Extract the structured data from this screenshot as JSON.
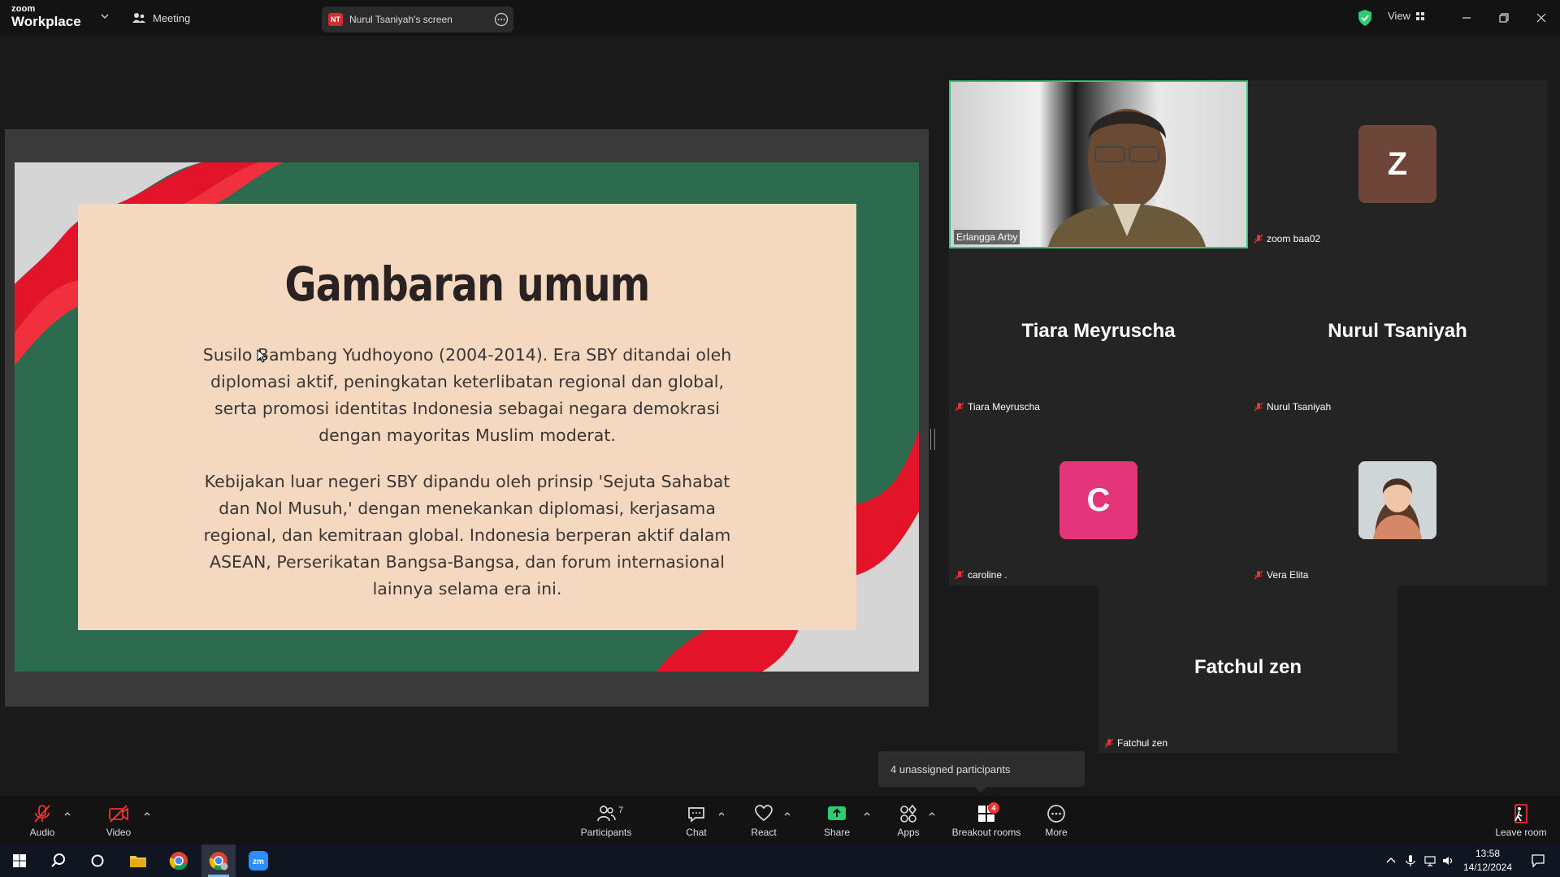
{
  "titlebar": {
    "logo_line1": "zoom",
    "logo_line2": "Workplace",
    "meeting_label": "Meeting",
    "share_badge": "NT",
    "share_label": "Nurul Tsaniyah's screen",
    "view_label": "View"
  },
  "slide": {
    "title": "Gambaran umum",
    "paragraph1": "Susilo Bambang Yudhoyono (2004-2014). Era SBY ditandai oleh diplomasi aktif, peningkatan keterlibatan regional dan global, serta promosi identitas Indonesia sebagai negara demokrasi dengan mayoritas Muslim moderat.",
    "paragraph2": "Kebijakan luar negeri SBY dipandu oleh prinsip 'Sejuta Sahabat dan Nol Musuh,' dengan menekankan diplomasi, kerjasama regional, dan kemitraan global. Indonesia berperan aktif dalam ASEAN, Perserikatan Bangsa-Bangsa, dan forum internasional lainnya selama era ini.",
    "colors": {
      "green": "#2d6b4f",
      "card": "#f4d9c0",
      "red": "#e3142a",
      "grey": "#d5d5d5"
    }
  },
  "participants_tiles": [
    {
      "name": "Erlangga Arby",
      "type": "video",
      "active": true
    },
    {
      "name": "zoom baa02",
      "type": "avatar",
      "initial": "Z",
      "color": "#6d4539"
    },
    {
      "name": "Tiara Meyruscha",
      "display": "Tiara Meyruscha",
      "type": "name"
    },
    {
      "name": "Nurul Tsaniyah",
      "display": "Nurul Tsaniyah",
      "type": "name"
    },
    {
      "name": "caroline .",
      "type": "avatar",
      "initial": "C",
      "color": "#e5357a"
    },
    {
      "name": "Vera Elita",
      "type": "photo"
    },
    {
      "name": "Fatchul zen",
      "display": "Fatchul zen",
      "type": "name"
    }
  ],
  "popup": {
    "text": "4 unassigned participants"
  },
  "toolbar": {
    "audio": "Audio",
    "video": "Video",
    "participants": "Participants",
    "participants_count": "7",
    "chat": "Chat",
    "react": "React",
    "share": "Share",
    "apps": "Apps",
    "breakout": "Breakout rooms",
    "breakout_badge": "4",
    "more": "More",
    "leave": "Leave room"
  },
  "taskbar": {
    "time": "13:58",
    "date": "14/12/2024"
  }
}
